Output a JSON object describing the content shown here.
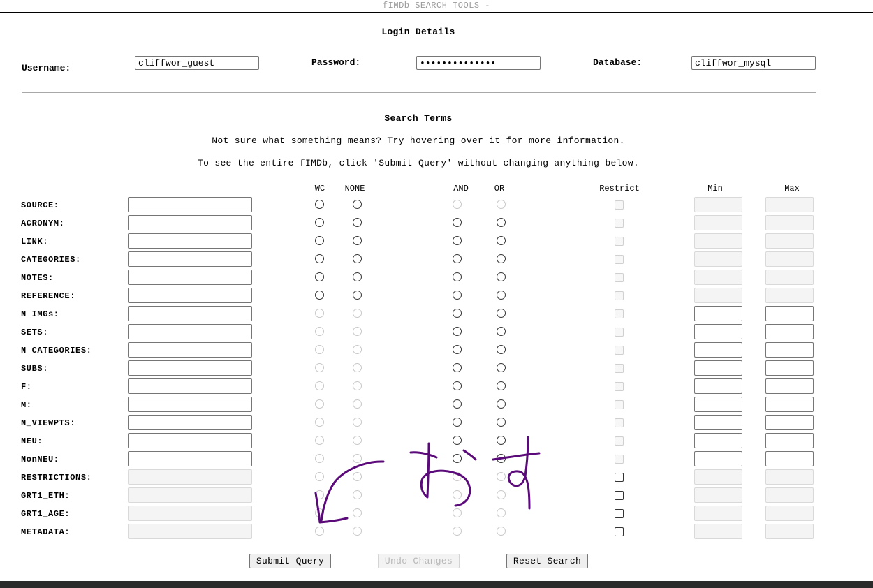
{
  "header": {
    "title": "fIMDb SEARCH TOOLS -"
  },
  "login": {
    "title": "Login Details",
    "username_label": "Username:",
    "username_value": "cliffwor_guest",
    "password_label": "Password:",
    "password_value": "••••••••••••••",
    "database_label": "Database:",
    "database_value": "cliffwor_mysql"
  },
  "search": {
    "title": "Search Terms",
    "hint1": "Not sure what something means? Try hovering over it for more information.",
    "hint2": "To see the entire fIMDb, click 'Submit Query' without changing anything below.",
    "columns": {
      "wc": "WC",
      "none": "NONE",
      "and": "AND",
      "or": "OR",
      "restrict": "Restrict",
      "min": "Min",
      "max": "Max"
    },
    "rows": [
      {
        "label": "SOURCE:",
        "text_enabled": true,
        "wc_none_enabled": true,
        "and_or_enabled": false,
        "restrict_enabled": false,
        "range_enabled": false
      },
      {
        "label": "ACRONYM:",
        "text_enabled": true,
        "wc_none_enabled": true,
        "and_or_enabled": true,
        "restrict_enabled": false,
        "range_enabled": false
      },
      {
        "label": "LINK:",
        "text_enabled": true,
        "wc_none_enabled": true,
        "and_or_enabled": true,
        "restrict_enabled": false,
        "range_enabled": false
      },
      {
        "label": "CATEGORIES:",
        "text_enabled": true,
        "wc_none_enabled": true,
        "and_or_enabled": true,
        "restrict_enabled": false,
        "range_enabled": false
      },
      {
        "label": "NOTES:",
        "text_enabled": true,
        "wc_none_enabled": true,
        "and_or_enabled": true,
        "restrict_enabled": false,
        "range_enabled": false
      },
      {
        "label": "REFERENCE:",
        "text_enabled": true,
        "wc_none_enabled": true,
        "and_or_enabled": true,
        "restrict_enabled": false,
        "range_enabled": false
      },
      {
        "label": "N IMGs:",
        "text_enabled": true,
        "wc_none_enabled": false,
        "and_or_enabled": true,
        "restrict_enabled": false,
        "range_enabled": true
      },
      {
        "label": "SETS:",
        "text_enabled": true,
        "wc_none_enabled": false,
        "and_or_enabled": true,
        "restrict_enabled": false,
        "range_enabled": true
      },
      {
        "label": "N CATEGORIES:",
        "text_enabled": true,
        "wc_none_enabled": false,
        "and_or_enabled": true,
        "restrict_enabled": false,
        "range_enabled": true
      },
      {
        "label": "SUBS:",
        "text_enabled": true,
        "wc_none_enabled": false,
        "and_or_enabled": true,
        "restrict_enabled": false,
        "range_enabled": true
      },
      {
        "label": "F:",
        "text_enabled": true,
        "wc_none_enabled": false,
        "and_or_enabled": true,
        "restrict_enabled": false,
        "range_enabled": true
      },
      {
        "label": "M:",
        "text_enabled": true,
        "wc_none_enabled": false,
        "and_or_enabled": true,
        "restrict_enabled": false,
        "range_enabled": true
      },
      {
        "label": "N_VIEWPTS:",
        "text_enabled": true,
        "wc_none_enabled": false,
        "and_or_enabled": true,
        "restrict_enabled": false,
        "range_enabled": true
      },
      {
        "label": "NEU:",
        "text_enabled": true,
        "wc_none_enabled": false,
        "and_or_enabled": true,
        "restrict_enabled": false,
        "range_enabled": true
      },
      {
        "label": "NonNEU:",
        "text_enabled": true,
        "wc_none_enabled": false,
        "and_or_enabled": true,
        "restrict_enabled": false,
        "range_enabled": true
      },
      {
        "label": "RESTRICTIONS:",
        "text_enabled": false,
        "wc_none_enabled": false,
        "and_or_enabled": false,
        "restrict_enabled": true,
        "range_enabled": false
      },
      {
        "label": "GRT1_ETH:",
        "text_enabled": false,
        "wc_none_enabled": false,
        "and_or_enabled": false,
        "restrict_enabled": true,
        "range_enabled": false
      },
      {
        "label": "GRT1_AGE:",
        "text_enabled": false,
        "wc_none_enabled": false,
        "and_or_enabled": false,
        "restrict_enabled": true,
        "range_enabled": false
      },
      {
        "label": "METADATA:",
        "text_enabled": false,
        "wc_none_enabled": false,
        "and_or_enabled": false,
        "restrict_enabled": true,
        "range_enabled": false
      }
    ]
  },
  "buttons": {
    "submit": "Submit Query",
    "undo": "Undo Changes",
    "reset": "Reset Search"
  },
  "annotation": {
    "text": "おす",
    "color": "#5b0a7a"
  }
}
